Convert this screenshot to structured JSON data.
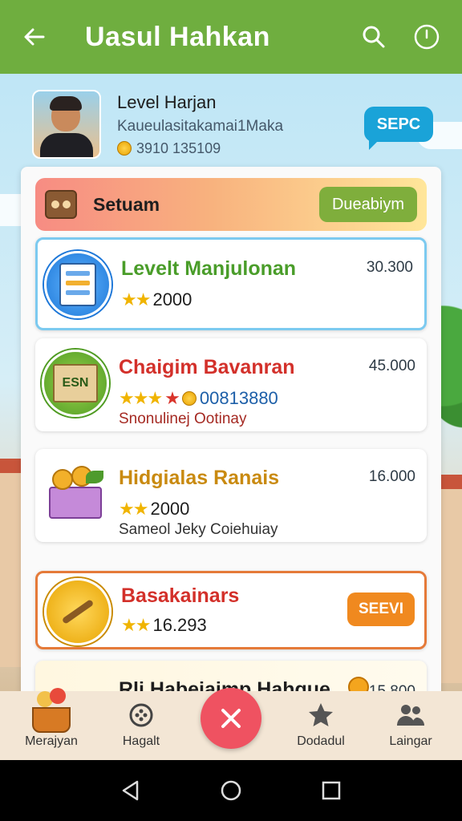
{
  "appbar": {
    "title": "Uasul Hahkan"
  },
  "profile": {
    "name": "Level Harjan",
    "subtitle": "Kaueulasitakamai1Maka",
    "points": "3910 135109",
    "badge": "SEPC"
  },
  "banner": {
    "label": "Setuam",
    "button": "Dueabiym"
  },
  "items": [
    {
      "title": "Levelt Manjulonan",
      "title_color": "#4a9d2a",
      "rating": "2000",
      "value": "30.300"
    },
    {
      "title": "Chaigim Bavanran",
      "title_color": "#d3302a",
      "rating": "00813880",
      "desc": "Snonulinej Ootinay",
      "value": "45.000"
    },
    {
      "title": "Hidgialas Ranais",
      "title_color": "#c98a10",
      "rating": "2000",
      "desc": "Sameol Jeky Coiehuiay",
      "value": "16.000"
    },
    {
      "title": "Basakainars",
      "title_color": "#d3302a",
      "rating": "16.293",
      "button": "SEEVI"
    },
    {
      "title": "Rli Habeiaimp Hahque",
      "value": "15.800"
    }
  ],
  "bottomnav": {
    "items": [
      {
        "label": "Merajyan"
      },
      {
        "label": "Hagalt"
      },
      {
        "label": "Dodadul"
      },
      {
        "label": "Laingar"
      }
    ]
  },
  "colors": {
    "appbar": "#6fae3f",
    "accent_blue": "#1aa3d8",
    "accent_orange": "#f0891f",
    "fab": "#ef5261"
  }
}
